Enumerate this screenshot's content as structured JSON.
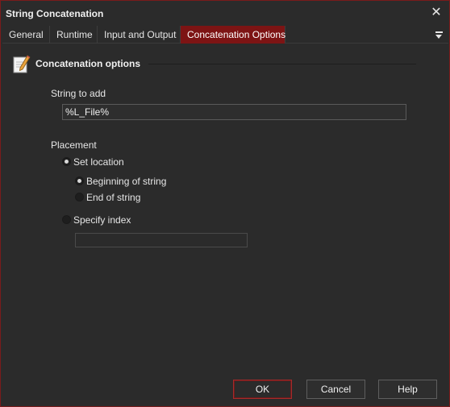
{
  "window": {
    "title": "String Concatenation",
    "close_glyph": "✕"
  },
  "tabs": [
    {
      "label": "General",
      "active": false
    },
    {
      "label": "Runtime",
      "active": false
    },
    {
      "label": "Input and Output",
      "active": false
    },
    {
      "label": "Concatenation Options",
      "active": true
    }
  ],
  "section": {
    "title": "Concatenation options",
    "icon": "pencil-document-icon"
  },
  "string_to_add": {
    "label": "String to add",
    "value": "%L_File%"
  },
  "placement": {
    "label": "Placement",
    "set_location": {
      "label": "Set location",
      "checked": true
    },
    "beginning": {
      "label": "Beginning of string",
      "checked": true
    },
    "end": {
      "label": "End of string",
      "checked": false
    },
    "specify_index": {
      "label": "Specify index",
      "checked": false
    },
    "index_value": ""
  },
  "buttons": {
    "ok": "OK",
    "cancel": "Cancel",
    "help": "Help"
  },
  "colors": {
    "accent": "#7d1414",
    "background": "#2b2b2b",
    "border": "#7a1b1b"
  }
}
